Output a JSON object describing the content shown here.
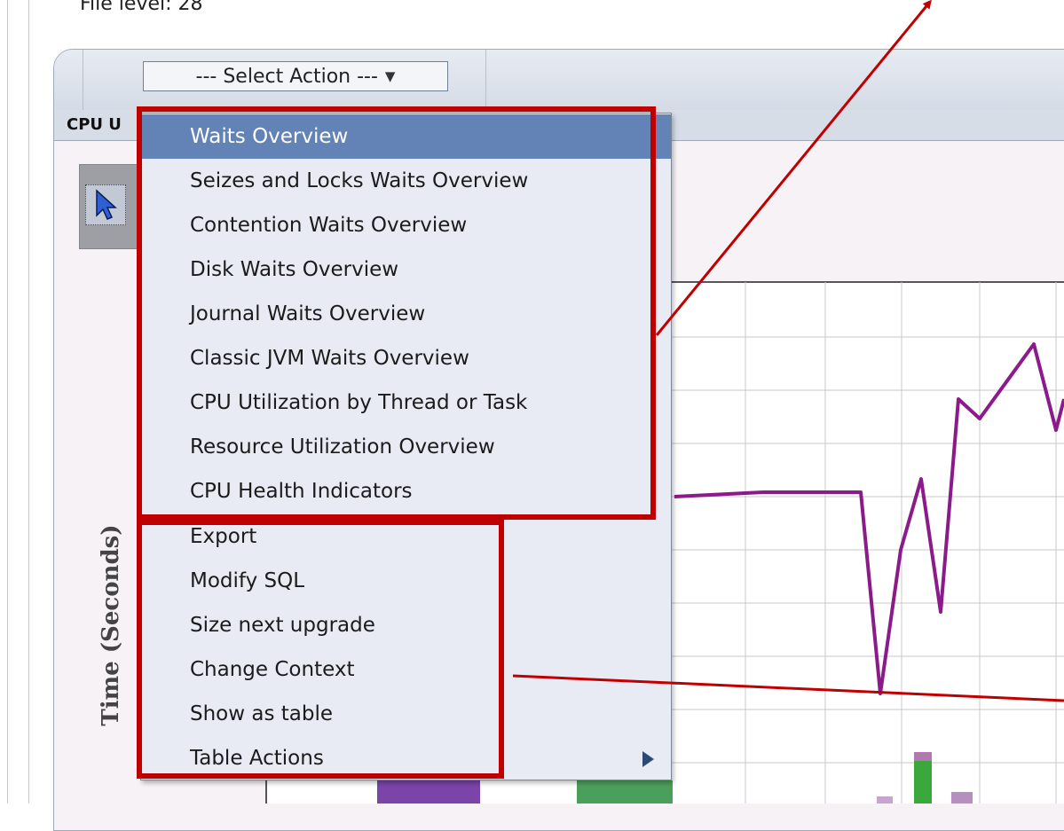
{
  "header": {
    "file_level_label": "File level:",
    "file_level_value": "28"
  },
  "toolbar": {
    "select_action_label": "--- Select Action ---"
  },
  "chart": {
    "title_fragment": "CPU U",
    "y_axis_label": "Time (Seconds)"
  },
  "menu": {
    "items": [
      {
        "label": "Waits Overview",
        "selected": true
      },
      {
        "label": "Seizes and Locks Waits Overview"
      },
      {
        "label": "Contention Waits Overview"
      },
      {
        "label": "Disk Waits Overview"
      },
      {
        "label": "Journal Waits Overview"
      },
      {
        "label": "Classic JVM Waits Overview"
      },
      {
        "label": "CPU Utilization by Thread or Task"
      },
      {
        "label": "Resource Utilization Overview"
      },
      {
        "label": "CPU Health Indicators"
      },
      {
        "label": "Export"
      },
      {
        "label": "Modify SQL"
      },
      {
        "label": "Size next upgrade"
      },
      {
        "label": "Change Context"
      },
      {
        "label": "Show as table"
      },
      {
        "label": "Table Actions",
        "has_submenu": true
      }
    ]
  },
  "colors": {
    "callout": "#c00000",
    "menu_highlight": "#6383b6",
    "series_line": "#8b1a8b",
    "menu_background": "#e8ebf4"
  },
  "icons": {
    "caret": "triangle-down-icon",
    "pointer": "arrow-pointer-icon",
    "submenu": "triangle-right-icon"
  }
}
